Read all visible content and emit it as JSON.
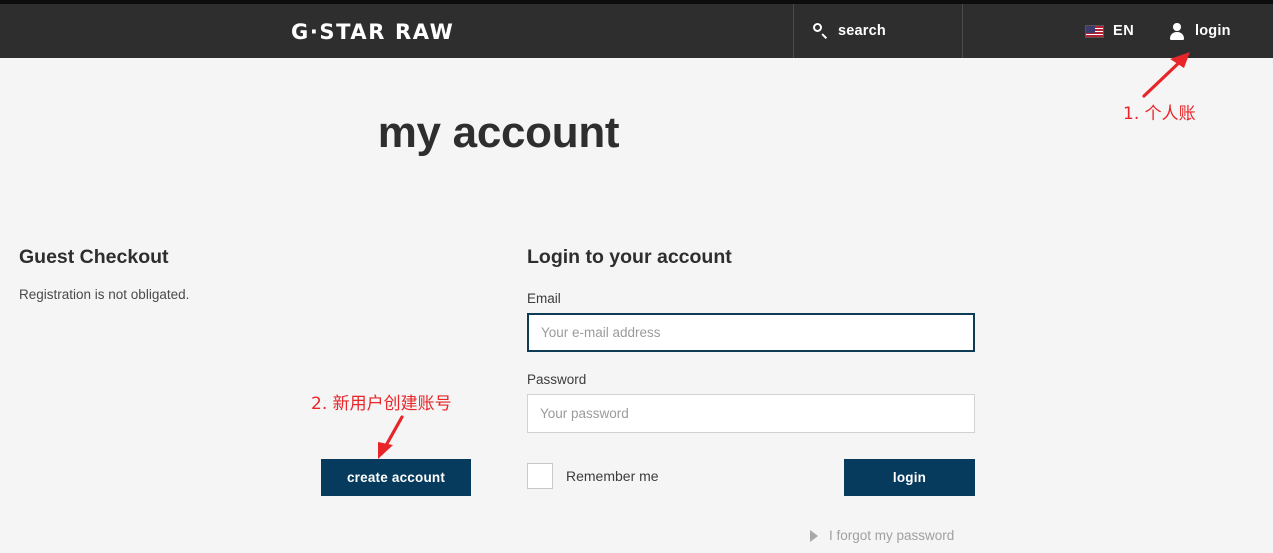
{
  "header": {
    "logo": "G·STAR RAW",
    "search_label": "search",
    "search_icon": "search-icon",
    "lang_code": "EN",
    "flag_icon": "us-flag-icon",
    "login_label": "login",
    "user_icon": "user-icon"
  },
  "page": {
    "title": "my account"
  },
  "guest": {
    "heading": "Guest Checkout",
    "subtext": "Registration is not obligated.",
    "create_account_label": "create account"
  },
  "login_form": {
    "heading": "Login to your account",
    "email_label": "Email",
    "email_value": "",
    "email_placeholder": "Your e-mail address",
    "password_label": "Password",
    "password_value": "",
    "password_placeholder": "Your password",
    "remember_label": "Remember me",
    "remember_checked": false,
    "login_button_label": "login",
    "forgot_label": "I forgot my password",
    "forgot_icon": "triangle-right-icon"
  },
  "annotations": [
    {
      "text": "1. 个人账",
      "arrow": "arrow-up-right"
    },
    {
      "text": "2. 新用户创建账号",
      "arrow": "arrow-down-left"
    }
  ],
  "colors": {
    "header_bg": "#2e2e2e",
    "page_bg": "#f5f5f5",
    "accent_navy": "#073b5e",
    "focus_border": "#0d3c55",
    "annotation_red": "#e8262a"
  }
}
